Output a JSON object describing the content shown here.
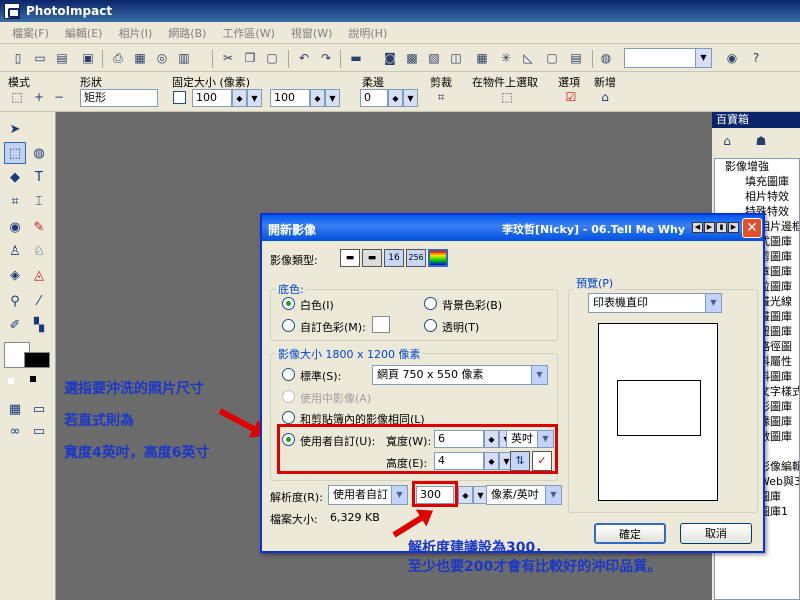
{
  "app": {
    "title": "PhotoImpact"
  },
  "menu": [
    "檔案(F)",
    "編輯(E)",
    "相片(I)",
    "網路(B)",
    "工作區(W)",
    "視窗(W)",
    "說明(H)"
  ],
  "attrbar": {
    "mode_label": "模式",
    "shape_label": "形狀",
    "shape_value": "矩形",
    "fixed_size_label": "固定大小 (像素)",
    "fixed_w": "100",
    "fixed_h": "100",
    "soft_label": "柔邊",
    "soft_value": "0",
    "crop_label": "剪裁",
    "select_on_object_label": "在物件上選取",
    "options_label": "選項",
    "new_label": "新增"
  },
  "right_panel": {
    "title": "百寶箱",
    "tree": [
      "影像增強",
      "填充圖庫",
      "相片特效",
      "特殊特效",
      "相片邊框",
      "式圖庫",
      "剪圖庫",
      "章圖庫",
      "粒圖庫",
      "畫光線",
      "畫圖庫",
      "鈕圖庫",
      "路徑圖",
      "料屬性",
      "料圖庫",
      "文字樣式",
      "形圖庫",
      "緣圖庫",
      "數圖庫",
      "",
      "影像編輯",
      "Web與3",
      "圖庫",
      "圖庫1"
    ]
  },
  "dialog": {
    "title": "開新影像",
    "song": "李玟哲[Nicky] - 06.Tell Me Why",
    "image_type_label": "影像類型:",
    "image_type_options": [
      "16",
      "256"
    ],
    "base_color_group": "底色:",
    "white": "白色(I)",
    "background_color": "背景色彩(B)",
    "custom_color": "自訂色彩(M):",
    "transparent": "透明(T)",
    "image_size_group": "影像大小 1800 x 1200 像素",
    "standard": "標準(S):",
    "standard_value": "網頁 750 x 550 像素",
    "use_active_image": "使用中影像(A)",
    "same_as_clipboard": "和剪貼簿內的影像相同(L)",
    "user_defined": "使用者自訂(U):",
    "width_label": "寬度(W):",
    "width_value": "6",
    "height_label": "高度(E):",
    "height_value": "4",
    "unit": "英吋",
    "resolution_label": "解析度(R):",
    "resolution_mode": "使用者自訂",
    "resolution_value": "300",
    "resolution_unit": "像素/英吋",
    "file_size_label": "檔案大小:",
    "file_size_value": "6,329 KB",
    "preview_label": "預覽(P)",
    "preview_value": "印表機直印",
    "ok": "確定",
    "cancel": "取消"
  },
  "annotations": {
    "left_line1": "選指要沖洗的照片尺寸",
    "left_line2": "若直式則為",
    "left_line3": "寬度4英吋，高度6英寸",
    "bottom_line1": "解析度建議設為300，",
    "bottom_line2": "至少也要200才會有比較好的沖印品質。"
  },
  "colors": {
    "annotation_text": "#1a37c8",
    "annotation_arrow": "#e00000"
  }
}
